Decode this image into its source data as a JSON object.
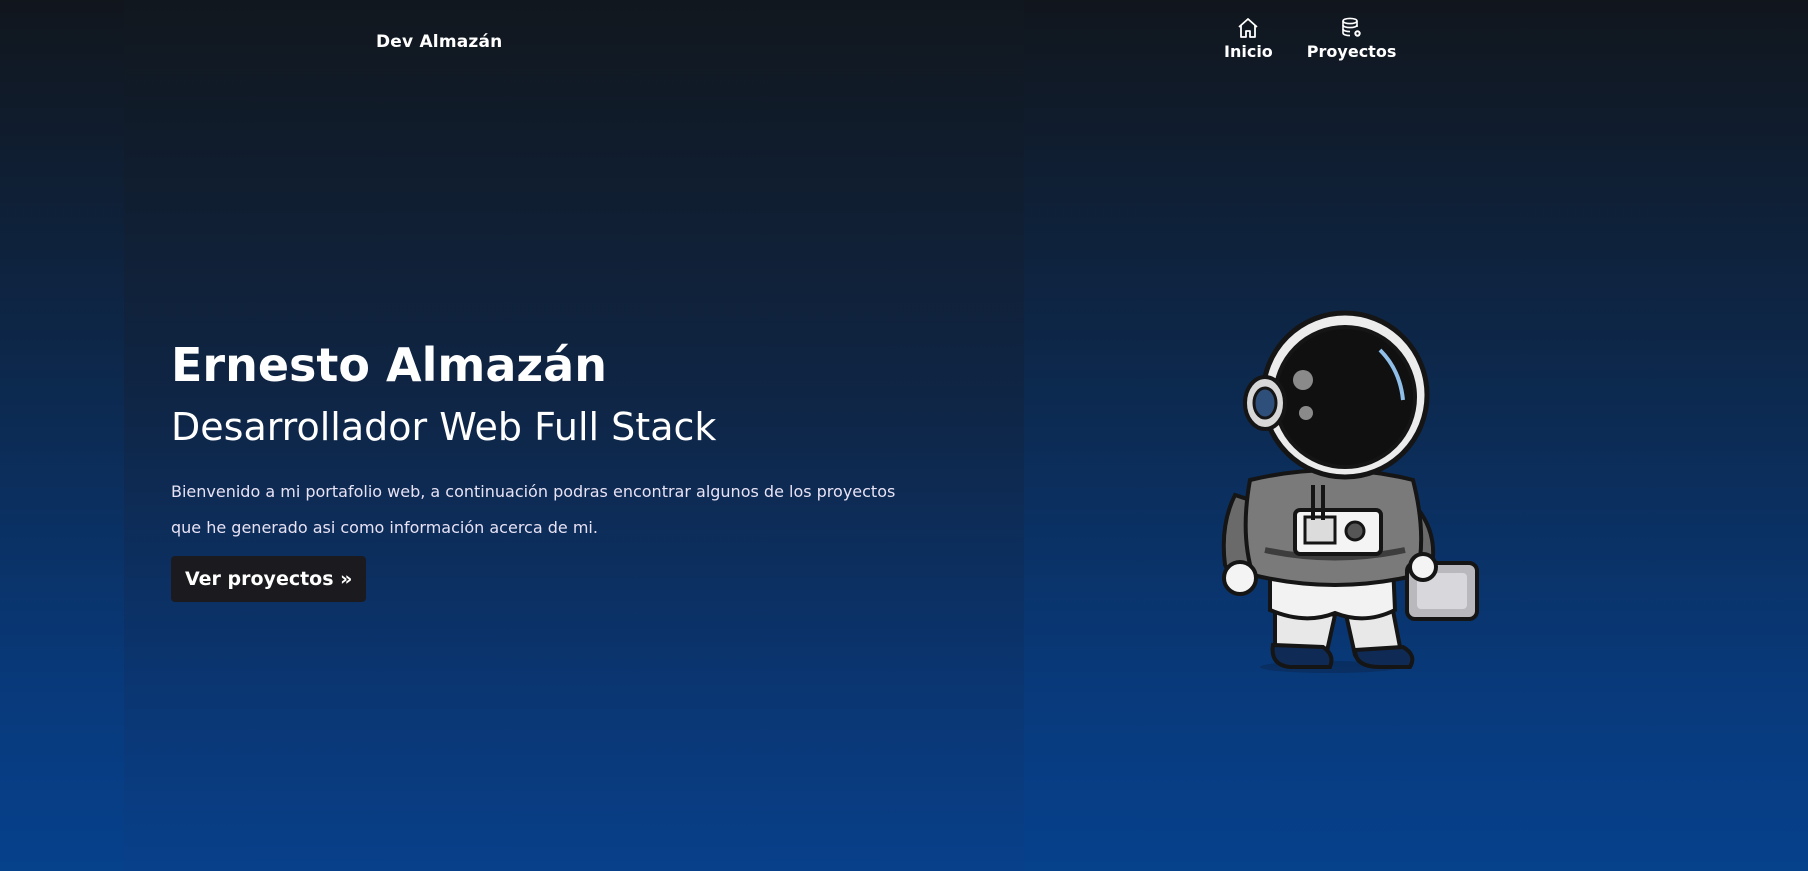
{
  "header": {
    "brand": "Dev Almazán",
    "nav": [
      {
        "label": "Inicio",
        "icon": "home-icon"
      },
      {
        "label": "Proyectos",
        "icon": "database-gear-icon"
      }
    ]
  },
  "hero": {
    "name": "Ernesto Almazán",
    "role": "Desarrollador Web Full Stack",
    "description": "Bienvenido a mi portafolio web, a continuación podras encontrar algunos de los proyectos que he generado asi como información acerca de mi.",
    "cta_label": "Ver proyectos »"
  },
  "colors": {
    "background_top": "#11161d",
    "background_bottom": "#06418c",
    "button_bg": "#1b1b1f",
    "text": "#ffffff"
  }
}
